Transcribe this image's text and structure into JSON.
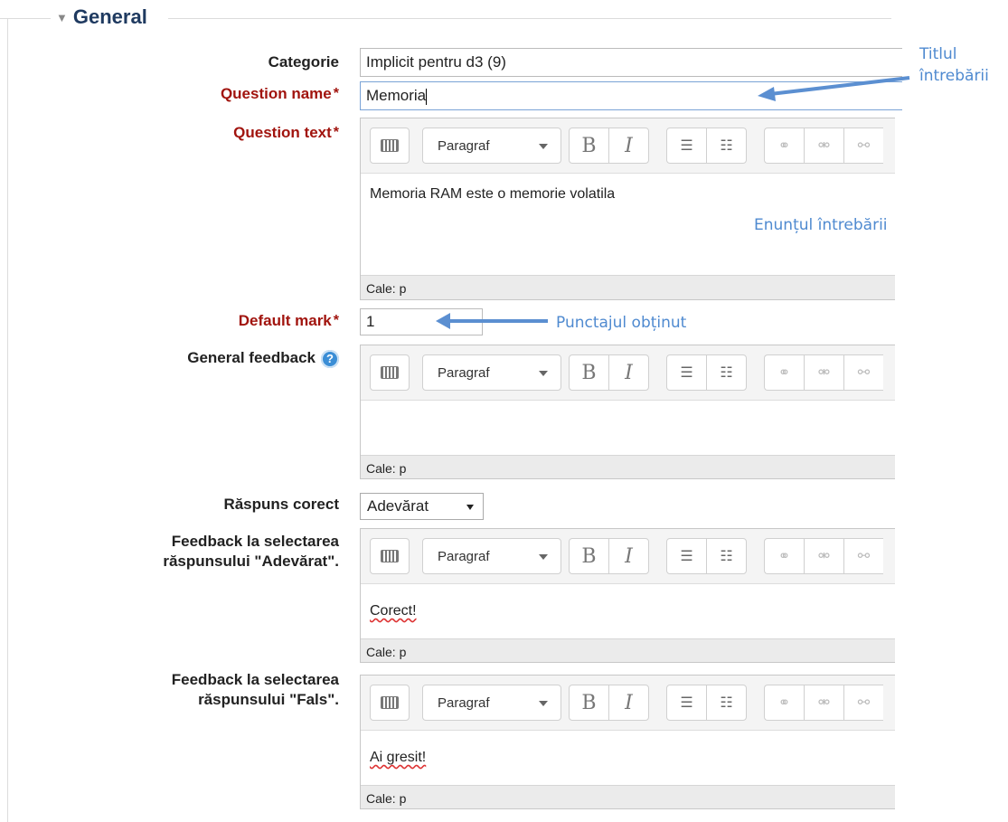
{
  "legend": "General",
  "categorie": {
    "label": "Categorie",
    "value": "Implicit pentru d3 (9)"
  },
  "question_name": {
    "label": "Question name",
    "value": "Memoria"
  },
  "question_text": {
    "label": "Question text",
    "content": "Memoria RAM este o memorie volatila",
    "path": "Cale: p"
  },
  "default_mark": {
    "label": "Default mark",
    "value": "1"
  },
  "general_feedback": {
    "label": "General feedback",
    "content": "",
    "path": "Cale: p",
    "help_icon": "question-circle-icon"
  },
  "raspuns_corect": {
    "label": "Răspuns corect",
    "selected": "Adevărat"
  },
  "feedback_true": {
    "label_line1": "Feedback la selectarea",
    "label_line2": "răspunsului \"Adevărat\".",
    "content": "Corect!",
    "path": "Cale: p"
  },
  "feedback_false": {
    "label_line1": "Feedback la selectarea",
    "label_line2": "răspunsului \"Fals\".",
    "content": "Ai gresit!",
    "path": "Cale: p"
  },
  "toolbar": {
    "paragraph_label": "Paragraf",
    "icons": [
      "keyboard-icon",
      "bold-icon",
      "italic-icon",
      "bullet-list-icon",
      "numbered-list-icon",
      "link-icon",
      "unlink-icon",
      "link-disabled-icon"
    ]
  },
  "annotations": {
    "title": [
      "Titlul",
      "întrebării"
    ],
    "statement": "Enunțul întrebării",
    "score": "Punctajul obținut"
  },
  "colors": {
    "required_label": "#a1140e",
    "legend": "#1f3a60",
    "annotation": "#4f8ad0"
  }
}
